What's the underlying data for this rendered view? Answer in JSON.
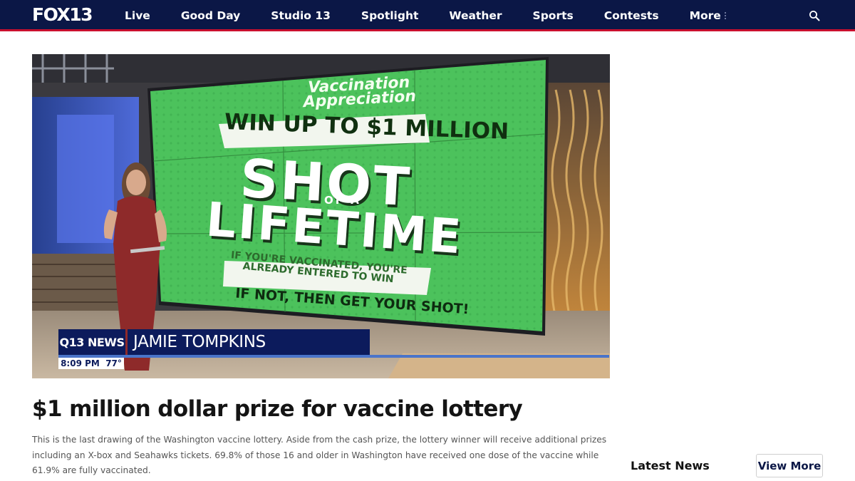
{
  "header": {
    "logo": "FOX13",
    "nav": [
      "Live",
      "Good Day",
      "Studio 13",
      "Spotlight",
      "Weather",
      "Sports",
      "Contests",
      "More"
    ],
    "search_icon": "search-icon"
  },
  "hero": {
    "screen": {
      "line1": "Vaccination",
      "line2": "Appreciation",
      "win": "WIN UP TO $1 MILLION",
      "shot": "SHOT",
      "of_a": "OF A",
      "lifetime": "LIFETIME",
      "entered_1": "IF YOU'RE VACCINATED, YOU'RE",
      "entered_2": "ALREADY ENTERED TO WIN",
      "get_shot": "IF NOT, THEN GET YOUR SHOT!"
    },
    "lower_third": {
      "brand": "Q13 NEWS",
      "name": "JAMIE TOMPKINS",
      "time": "8:09 PM",
      "temp": "77°"
    }
  },
  "article": {
    "headline": "$1 million dollar prize for vaccine lottery",
    "summary": "This is the last drawing of the Washington vaccine lottery. Aside from the cash prize, the lottery winner will receive additional prizes including an X-box and Seahawks tickets. 69.8% of those 16 and older in Washington have received one dose of the vaccine while 61.9% are fully vaccinated."
  },
  "sidebar": {
    "latest_title": "Latest News",
    "view_more": "View More"
  },
  "colors": {
    "nav_bg": "#0b1746",
    "nav_accent": "#c8102e",
    "screen_green": "#4cc25c",
    "lower_third": "#0c1b5c"
  }
}
